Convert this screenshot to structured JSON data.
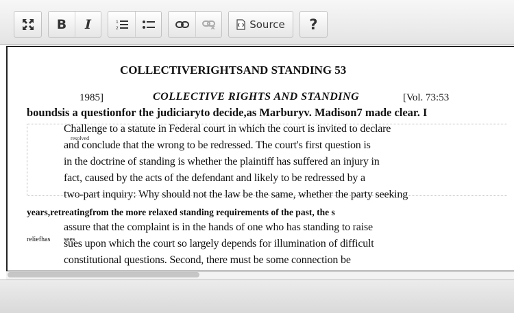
{
  "toolbar": {
    "maximize_icon": "expand-arrows-icon",
    "bold_label": "B",
    "italic_label": "I",
    "numbered_list_icon": "numbered-list-icon",
    "bulleted_list_icon": "bulleted-list-icon",
    "link_icon": "link-icon",
    "unlink_icon": "unlink-icon",
    "source_label": "Source",
    "help_label": "?"
  },
  "document": {
    "title": "COLLECTIVERIGHTSAND STANDING 53",
    "header_left": "1985]",
    "header_center": "COLLECTIVE RIGHTS AND STANDING",
    "header_right": "[Vol. 73:53",
    "bold_line": "boundsis a questionfor the judiciaryto decide,as Marburyv. Madison7 made clear. I",
    "small_note": "resolved",
    "lines": [
      "Challenge to a statute in Federal court in which the court is invited to declare",
      "and conclude that the wrong to be redressed. The court's first question is",
      "in the doctrine of standing is whether the plaintiff has suffered an injury in",
      "fact, caused by the acts of the defendant and likely to be redressed by a",
      "two-part inquiry: Why should not the law be the same, whether the party seeking",
      "years,retreatingfrom the more relaxed standing requirements of the past, the s",
      "assure that the complaint is in the hands of one who has standing to raise",
      "sues upon which the court so largely depends for illumination of difficult",
      "constitutional questions. Second, there must be some connection be"
    ],
    "years_line": "years,retreatingfrom the more relaxed standing requirements of the past, the s",
    "relief_label": "reliefhas",
    "sees_label": "sees"
  }
}
